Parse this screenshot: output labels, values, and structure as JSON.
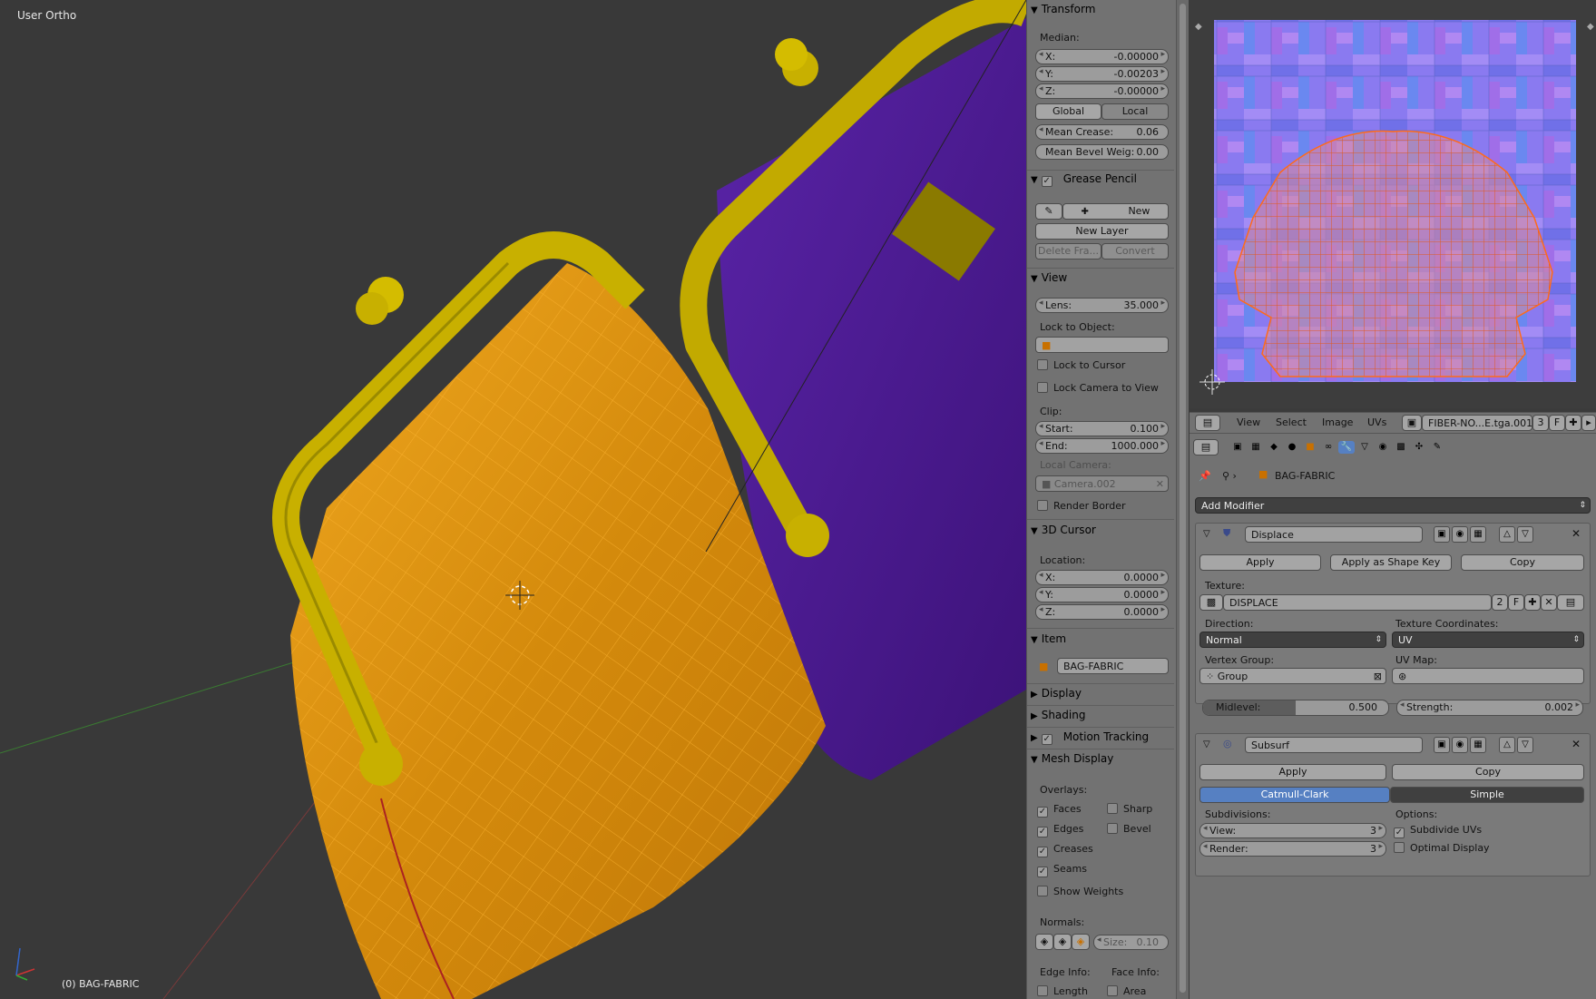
{
  "viewport": {
    "title": "User Ortho",
    "object_label": "(0) BAG-FABRIC"
  },
  "transform": {
    "header": "Transform",
    "median_label": "Median:",
    "x_label": "X:",
    "x": "-0.00000",
    "y_label": "Y:",
    "y": "-0.00203",
    "z_label": "Z:",
    "z": "-0.00000",
    "global": "Global",
    "local": "Local",
    "crease_label": "Mean Crease:",
    "crease": "0.06",
    "bevel_label": "Mean Bevel Weig:",
    "bevel": "0.00"
  },
  "grease": {
    "header": "Grease Pencil",
    "new": "New",
    "new_layer": "New Layer",
    "delete_frame": "Delete Fra...",
    "convert": "Convert"
  },
  "view": {
    "header": "View",
    "lens_label": "Lens:",
    "lens": "35.000",
    "lock_obj": "Lock to Object:",
    "lock_cursor": "Lock to Cursor",
    "lock_camera": "Lock Camera to View",
    "clip": "Clip:",
    "start_label": "Start:",
    "start": "0.100",
    "end_label": "End:",
    "end": "1000.000",
    "local_camera": "Local Camera:",
    "camera": "Camera.002",
    "render_border": "Render Border"
  },
  "cursor": {
    "header": "3D Cursor",
    "location": "Location:",
    "x_label": "X:",
    "x": "0.0000",
    "y_label": "Y:",
    "y": "0.0000",
    "z_label": "Z:",
    "z": "0.0000"
  },
  "item": {
    "header": "Item",
    "name": "BAG-FABRIC"
  },
  "collapsed": {
    "display": "Display",
    "shading": "Shading",
    "motion": "Motion Tracking"
  },
  "mesh_display": {
    "header": "Mesh Display",
    "overlays": "Overlays:",
    "faces": "Faces",
    "sharp": "Sharp",
    "edges": "Edges",
    "bevel": "Bevel",
    "creases": "Creases",
    "seams": "Seams",
    "weights": "Show Weights",
    "normals": "Normals:",
    "size_label": "Size:",
    "size": "0.10",
    "edge_info": "Edge Info:",
    "face_info": "Face Info:",
    "length": "Length",
    "area": "Area"
  },
  "uv_header": {
    "view": "View",
    "select": "Select",
    "image": "Image",
    "uvs": "UVs",
    "image_name": "FIBER-NO...E.tga.001",
    "users": "3",
    "fake": "F"
  },
  "props": {
    "object": "BAG-FABRIC",
    "add_modifier": "Add Modifier",
    "displace": {
      "name": "Displace",
      "apply": "Apply",
      "apply_shape": "Apply as Shape Key",
      "copy": "Copy",
      "texture_label": "Texture:",
      "texture": "DISPLACE",
      "tex_users": "2",
      "tex_fake": "F",
      "direction_label": "Direction:",
      "direction": "Normal",
      "coords_label": "Texture Coordinates:",
      "coords": "UV",
      "vgroup_label": "Vertex Group:",
      "vgroup": "Group",
      "uvmap_label": "UV Map:",
      "midlevel_label": "Midlevel:",
      "midlevel": "0.500",
      "midlevel_fraction": 0.5,
      "strength_label": "Strength:",
      "strength": "0.002"
    },
    "subsurf": {
      "name": "Subsurf",
      "apply": "Apply",
      "copy": "Copy",
      "catmull": "Catmull-Clark",
      "simple": "Simple",
      "subdivisions": "Subdivisions:",
      "view_label": "View:",
      "view": "3",
      "render_label": "Render:",
      "render": "3",
      "options": "Options:",
      "subdivide_uvs": "Subdivide UVs",
      "optimal": "Optimal Display"
    }
  },
  "colors": {
    "viewport_bg": "#393939",
    "panel_bg": "#727272",
    "accent": "#5680c2",
    "bag_orange": "#e39a10",
    "frame_gold": "#b8a000",
    "bag_purple": "#4b1a8a"
  }
}
